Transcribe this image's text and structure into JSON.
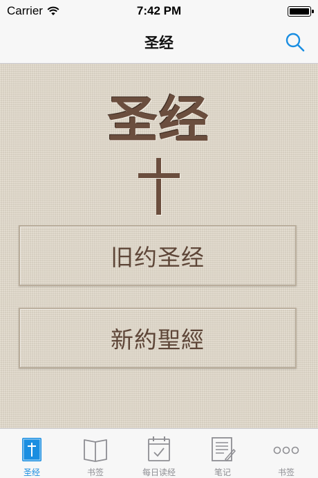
{
  "status_bar": {
    "carrier": "Carrier",
    "time": "7:42 PM"
  },
  "nav": {
    "title": "圣经"
  },
  "main": {
    "hero_title": "圣经",
    "old_testament_label": "旧约圣经",
    "new_testament_label": "新約聖經"
  },
  "tabs": [
    {
      "label": "圣经",
      "icon": "bible-icon",
      "active": true
    },
    {
      "label": "书签",
      "icon": "book-icon",
      "active": false
    },
    {
      "label": "每日读经",
      "icon": "calendar-icon",
      "active": false
    },
    {
      "label": "笔记",
      "icon": "notes-icon",
      "active": false
    },
    {
      "label": "书签",
      "icon": "more-icon",
      "active": false
    }
  ],
  "colors": {
    "accent": "#1a8ee1",
    "inactive": "#8e8e93",
    "brown": "#6b4e3e"
  }
}
